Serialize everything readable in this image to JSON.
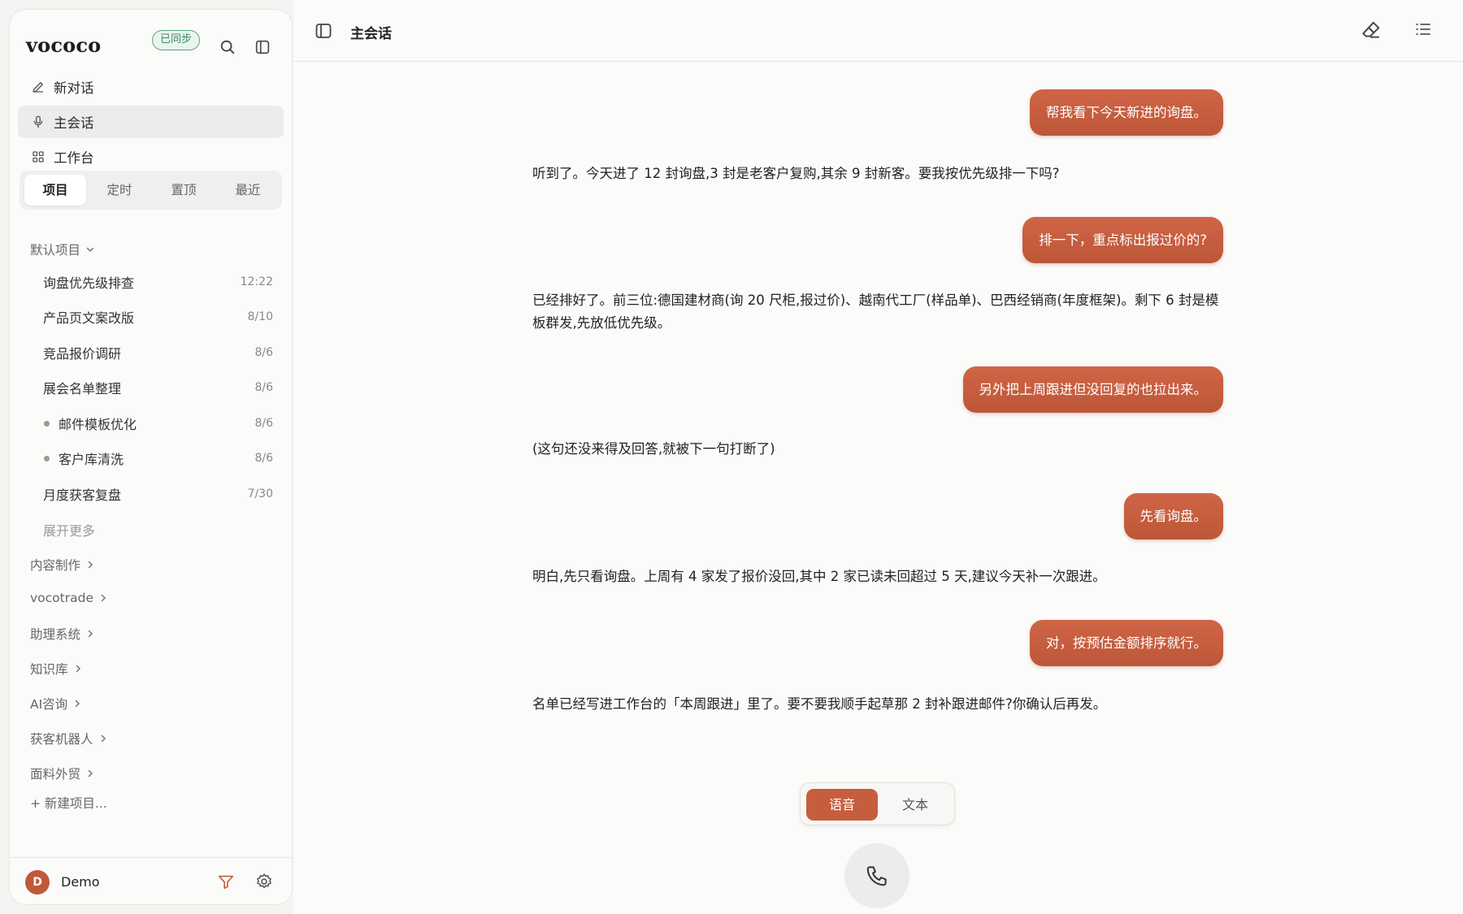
{
  "app": {
    "name": "vococo",
    "sync_status": "已同步"
  },
  "nav": {
    "new_chat": "新对话",
    "main_session": "主会话",
    "workbench": "工作台"
  },
  "segment_tabs": [
    "项目",
    "定时",
    "置顶",
    "最近"
  ],
  "default_group": {
    "title": "默认项目",
    "projects": [
      {
        "name": "询盘优先级排查",
        "time": "12:22",
        "dot": false
      },
      {
        "name": "产品页文案改版",
        "time": "8/10",
        "dot": false
      },
      {
        "name": "竞品报价调研",
        "time": "8/6",
        "dot": false
      },
      {
        "name": "展会名单整理",
        "time": "8/6",
        "dot": false
      },
      {
        "name": "邮件模板优化",
        "time": "8/6",
        "dot": true
      },
      {
        "name": "客户库清洗",
        "time": "8/6",
        "dot": true
      },
      {
        "name": "月度获客复盘",
        "time": "7/30",
        "dot": false
      }
    ],
    "expand_more": "展开更多"
  },
  "groups": [
    "内容制作",
    "vocotrade",
    "助理系统",
    "知识库",
    "AI咨询",
    "获客机器人",
    "面料外贸"
  ],
  "new_project": "+ 新建项目...",
  "user": {
    "initial": "D",
    "name": "Demo"
  },
  "conversation": {
    "title": "主会话",
    "messages": [
      {
        "role": "user",
        "text": "帮我看下今天新进的询盘。"
      },
      {
        "role": "assistant",
        "text": "听到了。今天进了 12 封询盘,3 封是老客户复购,其余 9 封新客。要我按优先级排一下吗?"
      },
      {
        "role": "user",
        "text": "排一下，重点标出报过价的?"
      },
      {
        "role": "assistant",
        "text": "已经排好了。前三位:德国建材商(询 20 尺柜,报过价)、越南代工厂(样品单)、巴西经销商(年度框架)。剩下 6 封是模板群发,先放低优先级。"
      },
      {
        "role": "user",
        "text": "另外把上周跟进但没回复的也拉出来。"
      },
      {
        "role": "assistant",
        "text": "(这句还没来得及回答,就被下一句打断了)"
      },
      {
        "role": "user",
        "text": "先看询盘。"
      },
      {
        "role": "assistant",
        "text": "明白,先只看询盘。上周有 4 家发了报价没回,其中 2 家已读未回超过 5 天,建议今天补一次跟进。"
      },
      {
        "role": "user",
        "text": "对，按预估金额排序就行。"
      },
      {
        "role": "assistant",
        "text": "名单已经写进工作台的「本周跟进」里了。要不要我顺手起草那 2 封补跟进邮件?你确认后再发。"
      }
    ]
  },
  "input_modes": {
    "voice": "语音",
    "text": "文本",
    "selected": "语音"
  },
  "colors": {
    "accent": "#c65e3e",
    "sync_green": "#3f8c63"
  }
}
